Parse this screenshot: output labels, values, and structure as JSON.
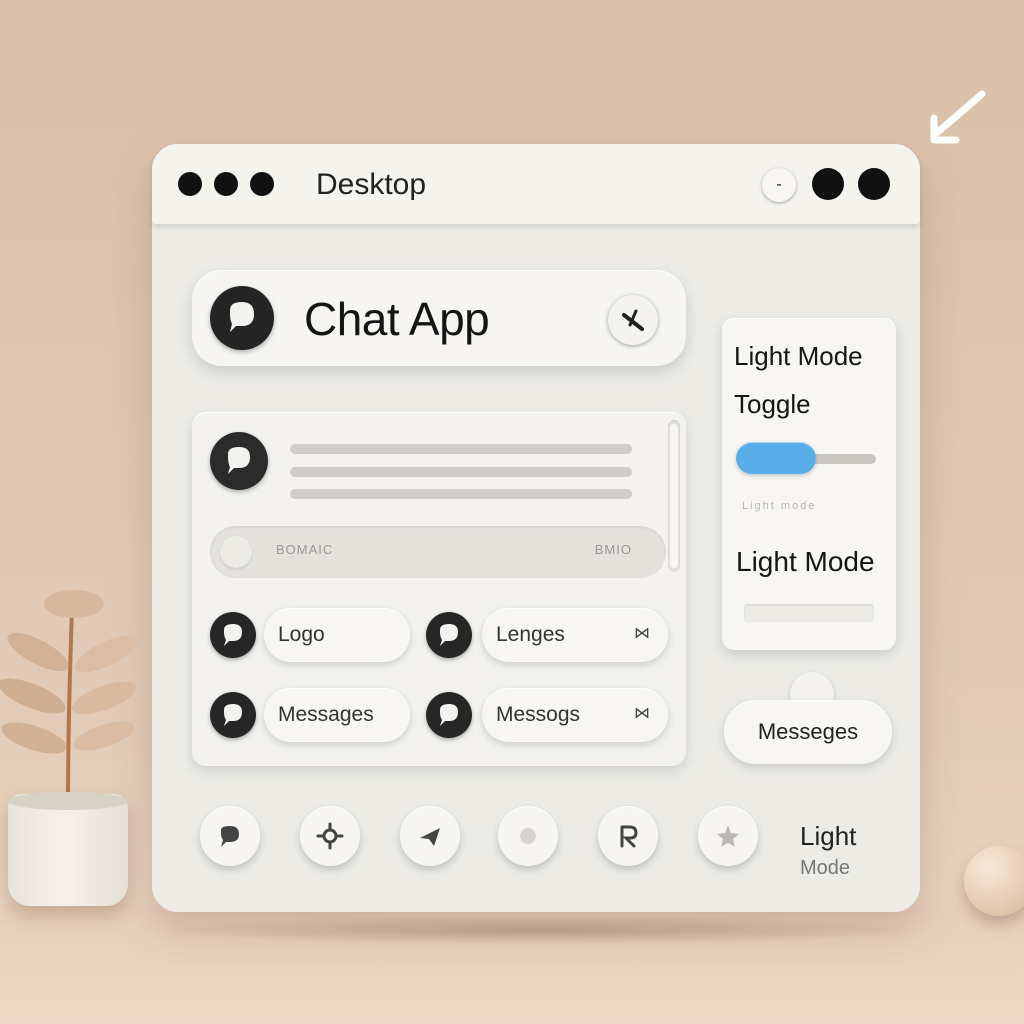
{
  "window": {
    "title": "Desktop",
    "controls": {
      "minimize_glyph": "-"
    }
  },
  "header": {
    "title": "Chat App",
    "logo_icon": "chat-bubble-icon",
    "action_icon": "pen-icon"
  },
  "chat_panel": {
    "input_placeholder": "BOMAIC",
    "send_text": "BMIO",
    "items": [
      {
        "label": "Logo",
        "icon": "chat-bubble-icon"
      },
      {
        "label": "Lenges",
        "icon": "chat-bubble-icon",
        "close_glyph": "⋈"
      },
      {
        "label": "Messages",
        "icon": "chat-bubble-icon"
      },
      {
        "label": "Messogs",
        "icon": "chat-bubble-icon",
        "close_glyph": "⋈"
      }
    ]
  },
  "side_panel": {
    "title": "Light Mode Toggle",
    "toggle_state": "on",
    "accent_color": "#5aaee8",
    "hint_text": "Light mode",
    "label": "Light Mode",
    "button_label": "Messeges"
  },
  "bottom_bar": {
    "icons": [
      "chat-icon",
      "gear-icon",
      "plane-icon",
      "circle-icon",
      "r-icon",
      "star-icon"
    ],
    "text_main": "Light",
    "text_sub": "Mode"
  }
}
